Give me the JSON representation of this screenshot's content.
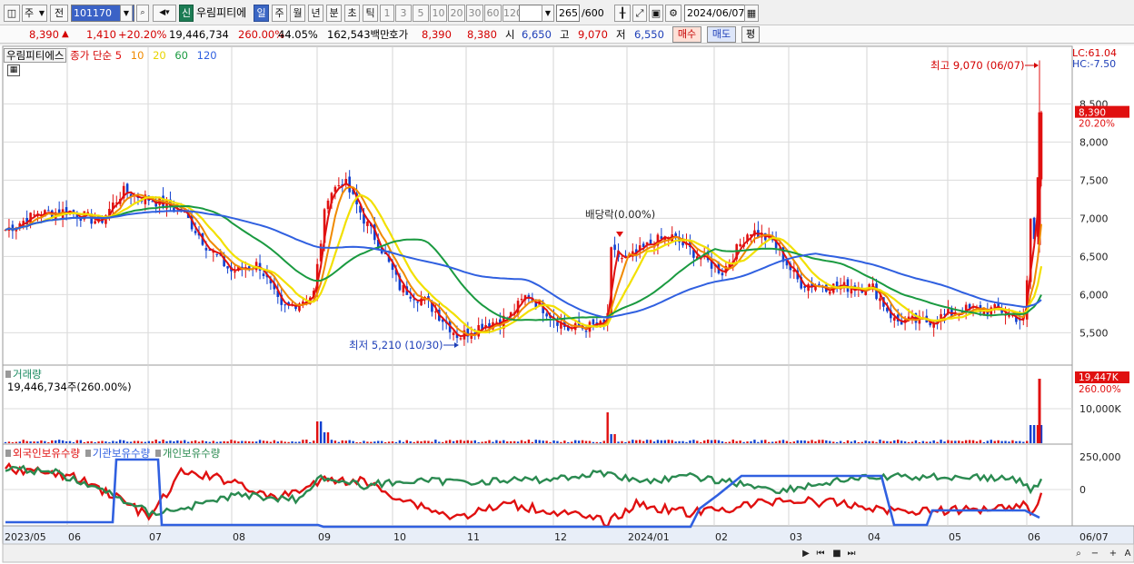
{
  "toolbar": {
    "period_type": "주",
    "prev_label": "전",
    "stock_code": "101170",
    "new_label": "신",
    "stock_name": "우림피티에",
    "periods": [
      "일",
      "주",
      "월",
      "년",
      "분",
      "초",
      "틱"
    ],
    "active_period": "일",
    "intervals": [
      "1",
      "3",
      "5",
      "10",
      "20",
      "30",
      "60",
      "120"
    ],
    "count": "265",
    "count_total": "/600",
    "date": "2024/06/07"
  },
  "quote": {
    "price": "8,390",
    "change": "1,410",
    "change_pct": "+20.20%",
    "volume": "19,446,734",
    "volume_ratio": "260.00%",
    "turnover": "44.05%",
    "amount": "162,543백만",
    "bid_ask_label": "호가",
    "ask": "8,390",
    "bid": "8,380",
    "open_label": "시",
    "open": "6,650",
    "high_label": "고",
    "high": "9,070",
    "low_label": "저",
    "low": "6,550",
    "buy_label": "매수",
    "sell_label": "매도",
    "eval_label": "평"
  },
  "price_panel": {
    "legend_name": "우림피티에스",
    "legend_ma_label": "종가 단순",
    "ma_periods": [
      "5",
      "10",
      "20",
      "60",
      "120"
    ],
    "ma_colors": [
      "#e01010",
      "#f08a00",
      "#f2e000",
      "#1a9a40",
      "#3060e0"
    ],
    "lc": "LC:61.04",
    "hc": "HC:-7.50",
    "y_ticks": [
      "8,500",
      "8,000",
      "7,500",
      "7,000",
      "6,500",
      "6,000",
      "5,500"
    ],
    "last_price_tag": "8,390",
    "last_pct_tag": "20.20%",
    "high_annotation": "최고 9,070 (06/07)",
    "low_annotation": "최저 5,210 (10/30)",
    "dividend_annotation": "배당락(0.00%)"
  },
  "volume_panel": {
    "title": "거래량",
    "value": "19,446,734주(260.00%)",
    "tag_value": "19,447K",
    "tag_pct": "260.00%",
    "y_tick": "10,000K"
  },
  "holding_panel": {
    "legend": [
      "외국인보유수량",
      "기관보유수량",
      "개인보유수량"
    ],
    "colors": [
      "#e01010",
      "#3060e0",
      "#2a8a50"
    ],
    "y_ticks": [
      "250,000",
      "0"
    ]
  },
  "x_axis": {
    "labels": [
      "2023/05",
      "06",
      "07",
      "08",
      "09",
      "10",
      "11",
      "12",
      "2024/01",
      "02",
      "03",
      "04",
      "05",
      "06",
      "06/07"
    ]
  }
}
